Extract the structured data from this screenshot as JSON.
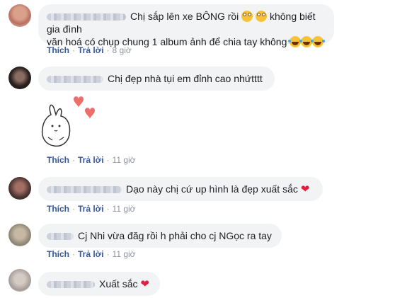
{
  "colors": {
    "link": "#385898",
    "bubble": "#f2f3f5",
    "heart": "#e41e3f"
  },
  "comments": [
    {
      "text_line1": "Chị sắp lên xe BÔNG rồi",
      "text_after_emoji": "không biết gia đình",
      "text_line2": "văn hoá có chụp chung 1 album ảnh để chia tay không",
      "like": "Thích",
      "reply": "Trả lời",
      "time": "8 giờ"
    },
    {
      "text": "Chị đẹp nhà tụi em đỉnh cao nhứtttt",
      "like": "Thích",
      "reply": "Trả lời",
      "time": "11 giờ"
    },
    {
      "text": "Dạo này chị cứ up hình là đẹp xuất sắc",
      "like": "Thích",
      "reply": "Trả lời",
      "time": "11 giờ"
    },
    {
      "text": "Cj Nhi vừa đăg rồi h phải cho cj NGọc ra tay",
      "like": "Thích",
      "reply": "Trả lời",
      "time": "11 giờ"
    },
    {
      "text": "Xuất sắc"
    }
  ],
  "dot": "·"
}
